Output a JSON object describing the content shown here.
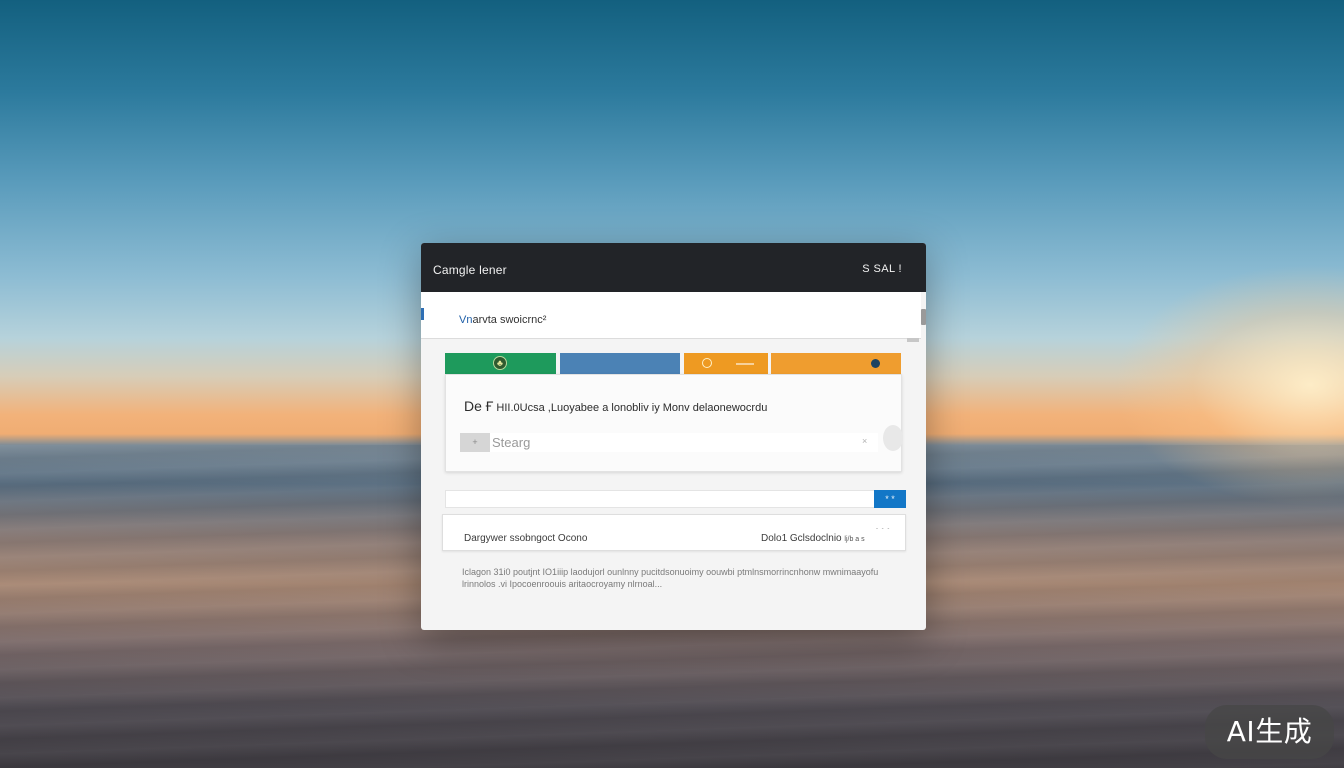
{
  "window": {
    "title": "Camgle lener",
    "title_right": "S SAL !"
  },
  "address_bar": {
    "text_prefix": "Vn",
    "text_rest": "arvta swoicrnc²"
  },
  "tiles": [
    {
      "name": "green",
      "color": "#1e9a5c",
      "icon": "tree-icon"
    },
    {
      "name": "blue",
      "color": "#4b82b5"
    },
    {
      "name": "orange",
      "color": "#ee9a22",
      "icon": "circle-icon"
    },
    {
      "name": "orange-light",
      "color": "#ef9d2f",
      "icon": "dot-icon"
    }
  ],
  "card": {
    "heading_big": "De Ғ",
    "heading_rest": " ΗΙΙ.0Ucsa ,Luoyabee a lonobliv iy Monv delaonewocrdu",
    "search_button": "+",
    "search_placeholder": "Stearg",
    "search_value": ""
  },
  "filter": {
    "button_label": "* *"
  },
  "info_row": {
    "left": "Dargywer ssobngoct Ocono",
    "right": "Dolo1 Gclsdoclnio",
    "badge": "lj/b a s",
    "dashes": "- - -"
  },
  "description": "Iclagon 31i0 poutjnt IO1iiip laodujorl ounlnny pucitdsonuoimy oouwbi ptmlnsmorrincnhonw mwnimaayofu lrinnolos .vi Ipocoenroouis aritaocroyamy nlrnoal...",
  "watermark": "AI生成"
}
